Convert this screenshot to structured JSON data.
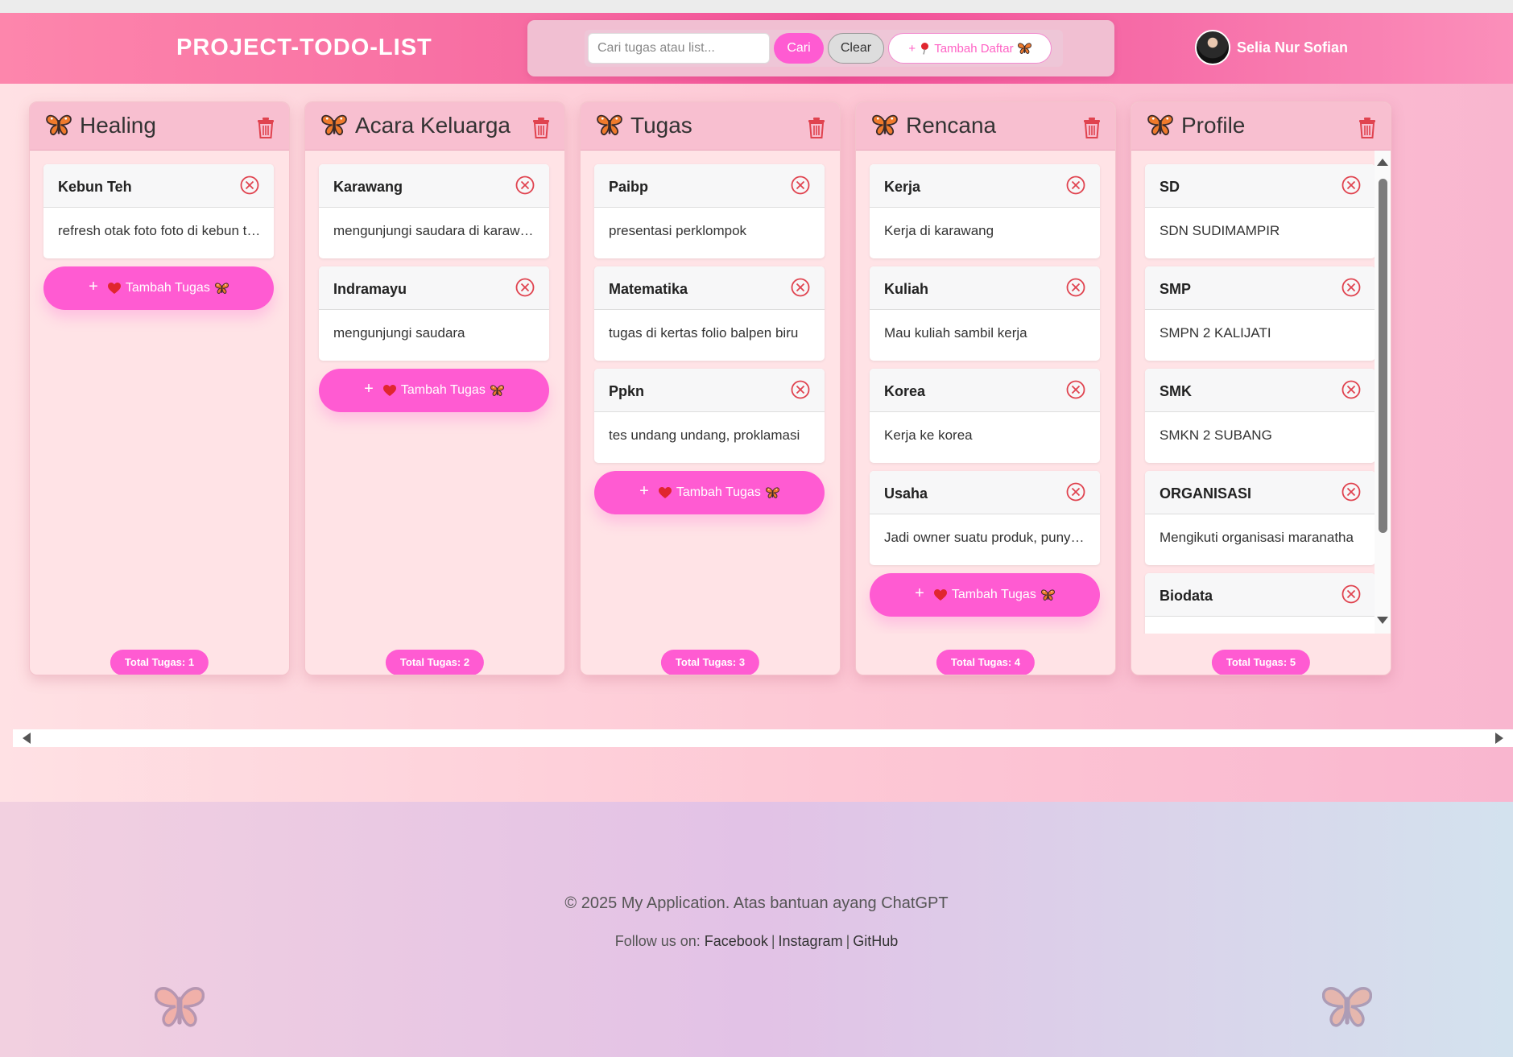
{
  "app": {
    "title": "PROJECT-TODO-LIST"
  },
  "search": {
    "placeholder": "Cari tugas atau list...",
    "value": "",
    "search_label": "Cari",
    "clear_label": "Clear",
    "add_list_label": "Tambah Daftar"
  },
  "user": {
    "name": "Selia Nur Sofian"
  },
  "add_task_label": "Tambah Tugas",
  "columns": [
    {
      "title": "Healing",
      "total_label": "Total Tugas: 1",
      "tasks": [
        {
          "title": "Kebun Teh",
          "desc": "refresh otak foto foto di kebun teh"
        }
      ]
    },
    {
      "title": "Acara Keluarga",
      "total_label": "Total Tugas: 2",
      "tasks": [
        {
          "title": "Karawang",
          "desc": "mengunjungi saudara di karawang"
        },
        {
          "title": "Indramayu",
          "desc": "mengunjungi saudara"
        }
      ]
    },
    {
      "title": "Tugas",
      "total_label": "Total Tugas: 3",
      "tasks": [
        {
          "title": "Paibp",
          "desc": "presentasi perklompok"
        },
        {
          "title": "Matematika",
          "desc": "tugas di kertas folio balpen biru"
        },
        {
          "title": "Ppkn",
          "desc": "tes undang undang, proklamasi"
        }
      ]
    },
    {
      "title": "Rencana",
      "total_label": "Total Tugas: 4",
      "tasks": [
        {
          "title": "Kerja",
          "desc": "Kerja di karawang"
        },
        {
          "title": "Kuliah",
          "desc": "Mau kuliah sambil kerja"
        },
        {
          "title": "Korea",
          "desc": "Kerja ke korea"
        },
        {
          "title": "Usaha",
          "desc": "Jadi owner suatu produk, punya usaha sendiri"
        }
      ]
    },
    {
      "title": "Profile",
      "total_label": "Total Tugas: 5",
      "tasks": [
        {
          "title": "SD",
          "desc": "SDN SUDIMAMPIR"
        },
        {
          "title": "SMP",
          "desc": "SMPN 2 KALIJATI"
        },
        {
          "title": "SMK",
          "desc": "SMKN 2 SUBANG"
        },
        {
          "title": "ORGANISASI",
          "desc": "Mengikuti organisasi maranatha"
        },
        {
          "title": "Biodata",
          "desc": ""
        }
      ]
    }
  ],
  "footer": {
    "copyright": "© 2025 My Application. Atas bantuan ayang ChatGPT",
    "follow_label": "Follow us on:",
    "links": [
      "Facebook",
      "Instagram",
      "GitHub"
    ]
  },
  "icons": {
    "butterfly": "butterfly-icon",
    "trash": "trash-icon",
    "close": "close-circle-icon",
    "heart": "heart-icon",
    "pin": "pin-icon",
    "plus": "plus-icon"
  },
  "colors": {
    "accent": "#ff5bd2",
    "header_pink": "#f24e97",
    "danger": "#e0434f"
  }
}
